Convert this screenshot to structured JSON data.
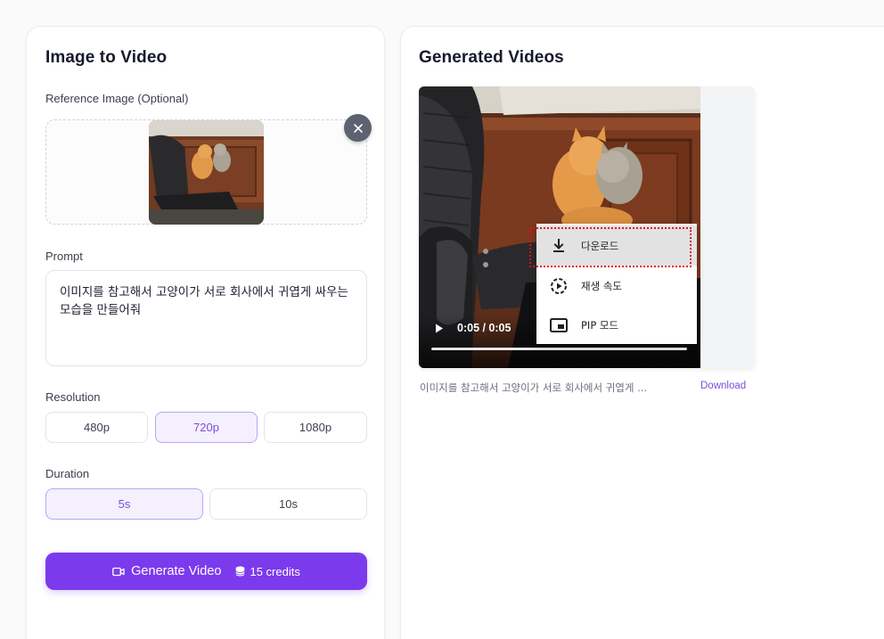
{
  "left_panel": {
    "title": "Image to Video",
    "reference_label": "Reference Image (Optional)",
    "prompt_label": "Prompt",
    "prompt_text": "이미지를 참고해서 고양이가 서로 회사에서 귀엽게 싸우는 모습을 만들어줘",
    "resolution_label": "Resolution",
    "resolutions": [
      "480p",
      "720p",
      "1080p"
    ],
    "selected_resolution": "720p",
    "duration_label": "Duration",
    "durations": [
      "5s",
      "10s"
    ],
    "selected_duration": "5s",
    "generate_label": "Generate Video",
    "credits_label": "15 credits"
  },
  "right_panel": {
    "title": "Generated Videos",
    "video_time": "0:05 / 0:05",
    "video_caption": "이미지를 참고해서 고양이가 서로 회사에서 귀엽게 ...",
    "download_link": "Download",
    "context_menu": [
      {
        "label": "다운로드",
        "icon": "download-icon"
      },
      {
        "label": "재생 속도",
        "icon": "playback-speed-icon"
      },
      {
        "label": "PIP 모드",
        "icon": "pip-icon"
      }
    ],
    "video_progress": 1.0
  },
  "colors": {
    "accent": "#7c3aed",
    "accent_light": "#f4f0fe",
    "highlight_outline": "#e0101a"
  }
}
